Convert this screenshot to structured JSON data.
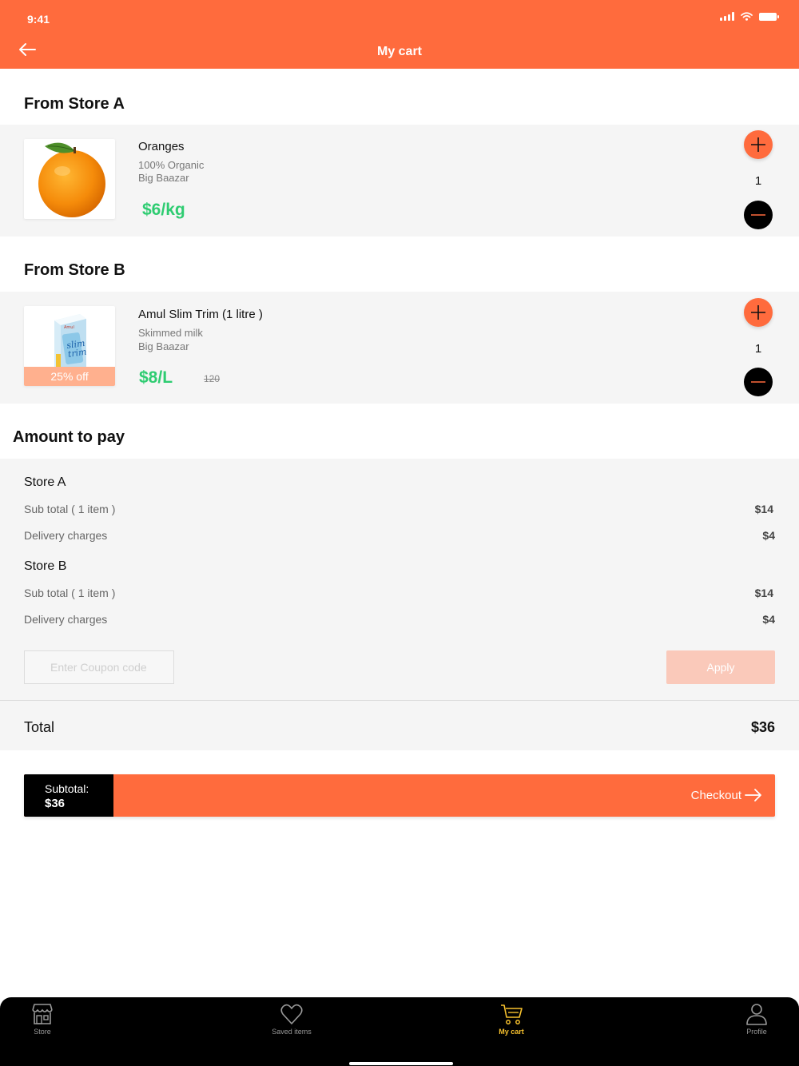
{
  "status_bar": {
    "time": "9:41"
  },
  "header": {
    "title": "My cart",
    "back_icon": "arrow-left-icon"
  },
  "stores": [
    {
      "title": "From Store A",
      "item": {
        "name": "Oranges",
        "detail": "100% Organic",
        "seller": "Big Baazar",
        "price": "$6/kg",
        "quantity": "1",
        "image": "orange-image"
      }
    },
    {
      "title": "From Store B",
      "item": {
        "name": "Amul Slim Trim (1 litre )",
        "detail": "Skimmed milk",
        "seller": "Big Baazar",
        "price": "$8/L",
        "old_price": "120",
        "discount": "25% off",
        "quantity": "1",
        "image": "milk-carton-image"
      }
    }
  ],
  "amount": {
    "title": "Amount to pay",
    "stores": [
      {
        "name": "Store A",
        "subtotal_label": "Sub total ( 1 item )",
        "subtotal_value": "$14",
        "delivery_label": "Delivery charges",
        "delivery_value": "$4"
      },
      {
        "name": "Store B",
        "subtotal_label": "Sub total ( 1 item )",
        "subtotal_value": "$14",
        "delivery_label": "Delivery charges",
        "delivery_value": "$4"
      }
    ],
    "coupon": {
      "placeholder": "Enter Coupon code",
      "value": "",
      "apply_label": "Apply"
    },
    "total_label": "Total",
    "total_value": "$36"
  },
  "checkout": {
    "subtotal_label": "Subtotal:",
    "subtotal_value": "$36",
    "button_label": "Checkout"
  },
  "bottom_nav": {
    "items": [
      {
        "label": "Store",
        "icon": "store-icon"
      },
      {
        "label": "Saved items",
        "icon": "heart-icon"
      },
      {
        "label": "My cart",
        "icon": "cart-icon",
        "active": true
      },
      {
        "label": "Profile",
        "icon": "user-icon"
      }
    ]
  },
  "colors": {
    "accent": "#FF6B3D",
    "price_green": "#2ECC71",
    "nav_active": "#F7C12D",
    "nav_background": "#000000"
  }
}
